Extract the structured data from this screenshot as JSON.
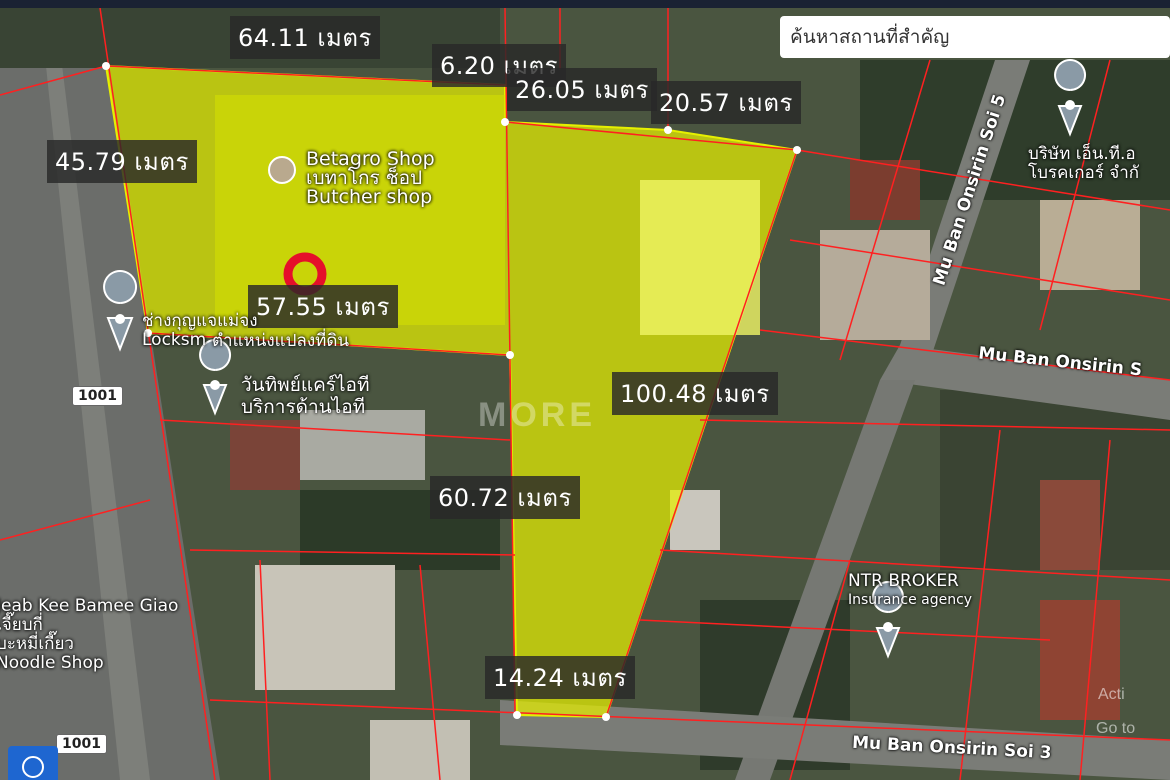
{
  "search": {
    "placeholder": "ค้นหาสถานที่สำคัญ"
  },
  "measurements": {
    "m1": "64.11 เมตร",
    "m2": "6.20 เมตร",
    "m3": "26.05 เมตร",
    "m4": "20.57 เมตร",
    "m5": "45.79 เมตร",
    "m6": "57.55 เมตร",
    "m7": "100.48 เมตร",
    "m8": "60.72 เมตร",
    "m9": "14.24 เมตร"
  },
  "pois": {
    "betagro_1": "Betagro Shop",
    "betagro_2": "เบทาโกร ช็อป",
    "betagro_3": "Butcher shop",
    "lock_1": "ช่างกุญแจแม่จง",
    "lock_2": "Locksm",
    "parcel": "ตำแหน่งแปลงที่ดิน",
    "wan_1": "วันทิพย์แคร์ไอที",
    "wan_2": "บริการด้านไอที",
    "ntr_1": "NTR BROKER",
    "ntr_2": "Insurance agency",
    "noodle_1": "Jeab Kee Bamee Giao",
    "noodle_2": "เจี๊ยบกี่",
    "noodle_3": "บะหมี่เกี๊ยว",
    "noodle_4": "Noodle Shop",
    "company_1": "บริษัท เอ็น.ที.อ",
    "company_2": "โบรคเกอร์ จำกั"
  },
  "roads": {
    "onsirin": "Mu Ban Onsirin S",
    "soi5": "Mu Ban Onsirin Soi 5",
    "soi3": "Mu Ban Onsirin Soi 3",
    "route_top": "1001",
    "route_bottom": "1001"
  },
  "watermark": "MORE",
  "corner_text": {
    "active": "Acti",
    "go": "Go to"
  },
  "colors": {
    "parcel_fill": "#e6f000",
    "boundary": "#e11",
    "marker": "#e5102a"
  }
}
